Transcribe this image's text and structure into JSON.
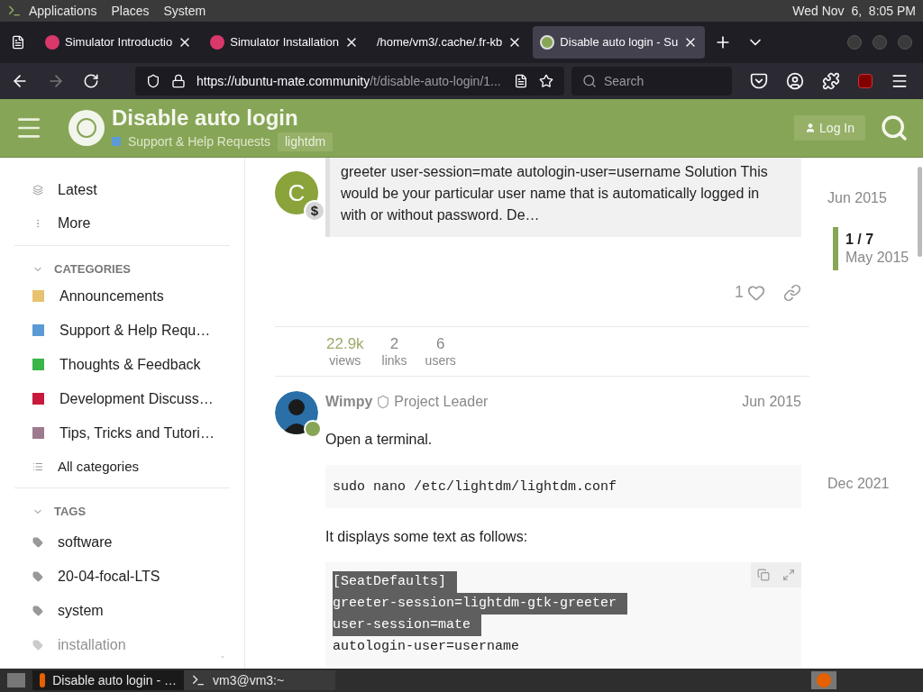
{
  "panel": {
    "menus": [
      "Applications",
      "Places",
      "System"
    ],
    "clock": "Wed Nov  6,  8:05 PM"
  },
  "tabs": [
    {
      "title": "Simulator Introductio",
      "kind": "discourse",
      "selected": false
    },
    {
      "title": "Simulator Installation",
      "kind": "discourse",
      "selected": false
    },
    {
      "title": "/home/vm3/.cache/.fr-kb",
      "kind": "plain",
      "selected": false
    },
    {
      "title": "Disable auto login - Su",
      "kind": "mate",
      "selected": true
    }
  ],
  "url": {
    "host": "https://ubuntu-mate.community",
    "path": "/t/disable-auto-login/1..."
  },
  "search": {
    "placeholder": "Search"
  },
  "header": {
    "title": "Disable auto login",
    "category": "Support & Help Requests",
    "tag": "lightdm",
    "login": "Log In"
  },
  "sidebar": {
    "top": [
      "Latest",
      "More"
    ],
    "categories_title": "CATEGORIES",
    "categories": [
      {
        "name": "Announcements",
        "color": "#e8c270"
      },
      {
        "name": "Support & Help Requ…",
        "color": "#5c9ad6"
      },
      {
        "name": "Thoughts & Feedback",
        "color": "#3ab54a"
      },
      {
        "name": "Development Discuss…",
        "color": "#c8193c"
      },
      {
        "name": "Tips, Tricks and Tutori…",
        "color": "#9e7a8e"
      }
    ],
    "all_categories": "All categories",
    "tags_title": "TAGS",
    "tags": [
      "software",
      "20-04-focal-LTS",
      "system",
      "installation"
    ]
  },
  "first_post": {
    "avatar_letter": "C",
    "badge": "$",
    "quote": "greeter user-session=mate autologin-user=username Solution This would be your particular user name that is automatically logged in with or without password. De…",
    "likes": "1"
  },
  "stats": [
    {
      "value": "22.9k",
      "label": "views"
    },
    {
      "value": "2",
      "label": "links"
    },
    {
      "value": "6",
      "label": "users"
    }
  ],
  "post": {
    "author": "Wimpy",
    "role": "Project Leader",
    "date": "Jun 2015",
    "intro": "Open a terminal.",
    "command": "sudo nano /etc/lightdm/lightdm.conf",
    "text": "It displays some text as follows:",
    "code": [
      {
        "line": "[SeatDefaults]",
        "highlighted": true
      },
      {
        "line": "greeter-session=lightdm-gtk-greeter",
        "highlighted": true
      },
      {
        "line": "user-session=mate",
        "highlighted": true
      },
      {
        "line": "autologin-user=username",
        "highlighted": false
      }
    ]
  },
  "timeline": {
    "start": "Jun 2015",
    "position": "1 / 7",
    "position_date": "May 2015",
    "end": "Dec 2021"
  },
  "taskbar": [
    {
      "title": "Disable auto login - …",
      "selected": true
    },
    {
      "title": "vm3@vm3:~",
      "selected": false
    }
  ]
}
